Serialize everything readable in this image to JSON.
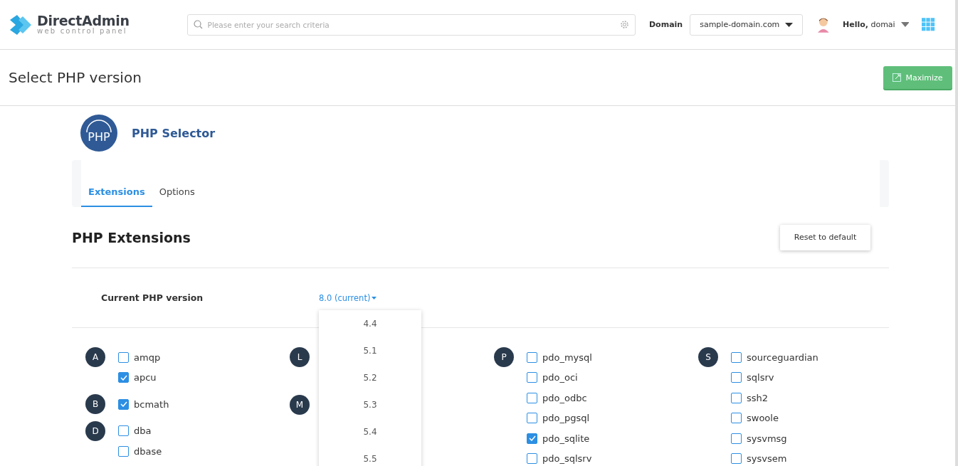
{
  "header": {
    "logo_title": "DirectAdmin",
    "logo_subtitle": "web control panel",
    "search": {
      "placeholder": "Please enter your search criteria"
    },
    "domain_label": "Domain",
    "domain_value": "sample-domain.com",
    "greeting": "Hello, domai"
  },
  "page": {
    "title": "Select PHP version",
    "maximize_button": "Maximize"
  },
  "selector": {
    "icon_text": "PHP",
    "title": "PHP Selector"
  },
  "tabs": [
    {
      "label": "Extensions",
      "selected": true
    },
    {
      "label": "Options",
      "selected": false
    }
  ],
  "extensions": {
    "heading": "PHP Extensions",
    "reset_button": "Reset to default",
    "version_label": "Current PHP version",
    "version_value": "8.0 (current)",
    "version_menu": [
      "4.4",
      "5.1",
      "5.2",
      "5.3",
      "5.4",
      "5.5"
    ],
    "columns": [
      [
        {
          "letter": "A",
          "items": [
            {
              "name": "amqp",
              "checked": false
            },
            {
              "name": "apcu",
              "checked": true
            }
          ]
        },
        {
          "letter": "B",
          "items": [
            {
              "name": "bcmath",
              "checked": true
            }
          ]
        },
        {
          "letter": "D",
          "items": [
            {
              "name": "dba",
              "checked": false
            },
            {
              "name": "dbase",
              "checked": false
            }
          ]
        }
      ],
      [
        {
          "letter": "L"
        },
        {
          "letter": "M"
        }
      ],
      [
        {
          "letter": "P",
          "items": [
            {
              "name": "pdo_mysql",
              "checked": false
            },
            {
              "name": "pdo_oci",
              "checked": false
            },
            {
              "name": "pdo_odbc",
              "checked": false
            },
            {
              "name": "pdo_pgsql",
              "checked": false
            },
            {
              "name": "pdo_sqlite",
              "checked": true
            },
            {
              "name": "pdo_sqlsrv",
              "checked": false
            }
          ]
        }
      ],
      [
        {
          "letter": "S",
          "items": [
            {
              "name": "sourceguardian",
              "checked": false
            },
            {
              "name": "sqlsrv",
              "checked": false
            },
            {
              "name": "ssh2",
              "checked": false
            },
            {
              "name": "swoole",
              "checked": false
            },
            {
              "name": "sysvmsg",
              "checked": false
            },
            {
              "name": "sysvsem",
              "checked": false
            }
          ]
        }
      ]
    ]
  }
}
